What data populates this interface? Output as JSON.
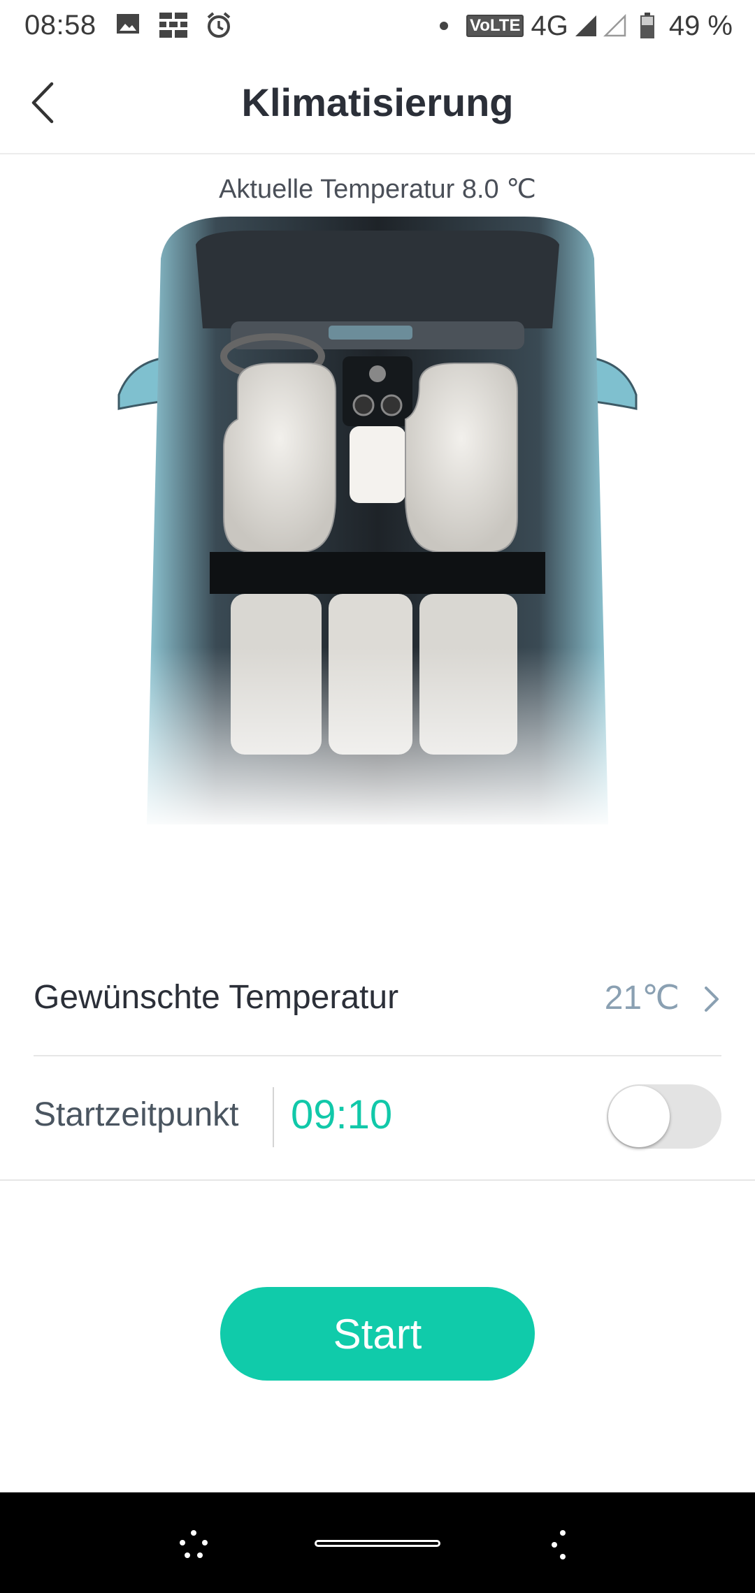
{
  "status_bar": {
    "time": "08:58",
    "network_badge": "VoLTE",
    "network": "4G",
    "battery": "49 %",
    "icons": [
      "image-icon",
      "grid-icon",
      "alarm-icon",
      "dot-icon",
      "signal-icon",
      "signal-empty-icon",
      "battery-icon"
    ]
  },
  "header": {
    "title": "Klimatisierung",
    "back_icon": "back-chevron-icon"
  },
  "current_temperature": "Aktuelle Temperatur 8.0 ℃",
  "desired_temperature": {
    "label": "Gewünschte Temperatur",
    "value": "21℃"
  },
  "start_time": {
    "label": "Startzeitpunkt",
    "value": "09:10",
    "enabled": false
  },
  "start_button": {
    "label": "Start"
  },
  "colors": {
    "accent": "#10cbaa",
    "value_gray": "#8aa0b2",
    "text": "#2b2f38"
  }
}
